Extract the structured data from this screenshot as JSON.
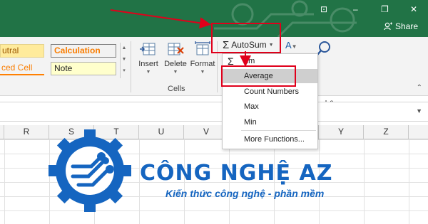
{
  "window": {
    "share_label": "Share",
    "controls": [
      "⊡",
      "–",
      "❐",
      "✕"
    ]
  },
  "styles": {
    "neutral": "utral",
    "calculation": "Calculation",
    "linked_cell": "ced Cell",
    "note": "Note"
  },
  "cells_group": {
    "label": "Cells",
    "insert": "Insert",
    "delete": "Delete",
    "format": "Format"
  },
  "editing": {
    "autosum_label": "AutoSum",
    "sort_filter_fragment": "nd &",
    "select_fragment": "ect"
  },
  "autosum_menu": {
    "items": [
      {
        "label": "Sum",
        "shown": "um"
      },
      {
        "label": "Average"
      },
      {
        "label": "Count Numbers"
      },
      {
        "label": "Max"
      },
      {
        "label": "Min"
      },
      {
        "label": "More Functions..."
      }
    ],
    "selected": "Average"
  },
  "columns": [
    "R",
    "S",
    "T",
    "U",
    "V",
    "W",
    "X",
    "Y",
    "Z"
  ],
  "watermark": {
    "title": "CÔNG NGHỆ AZ",
    "subtitle": "Kiến thức công nghệ - phần mềm"
  },
  "colors": {
    "excel_green": "#217346",
    "highlight_red": "#e0001b",
    "watermark_blue": "#1565c0"
  }
}
